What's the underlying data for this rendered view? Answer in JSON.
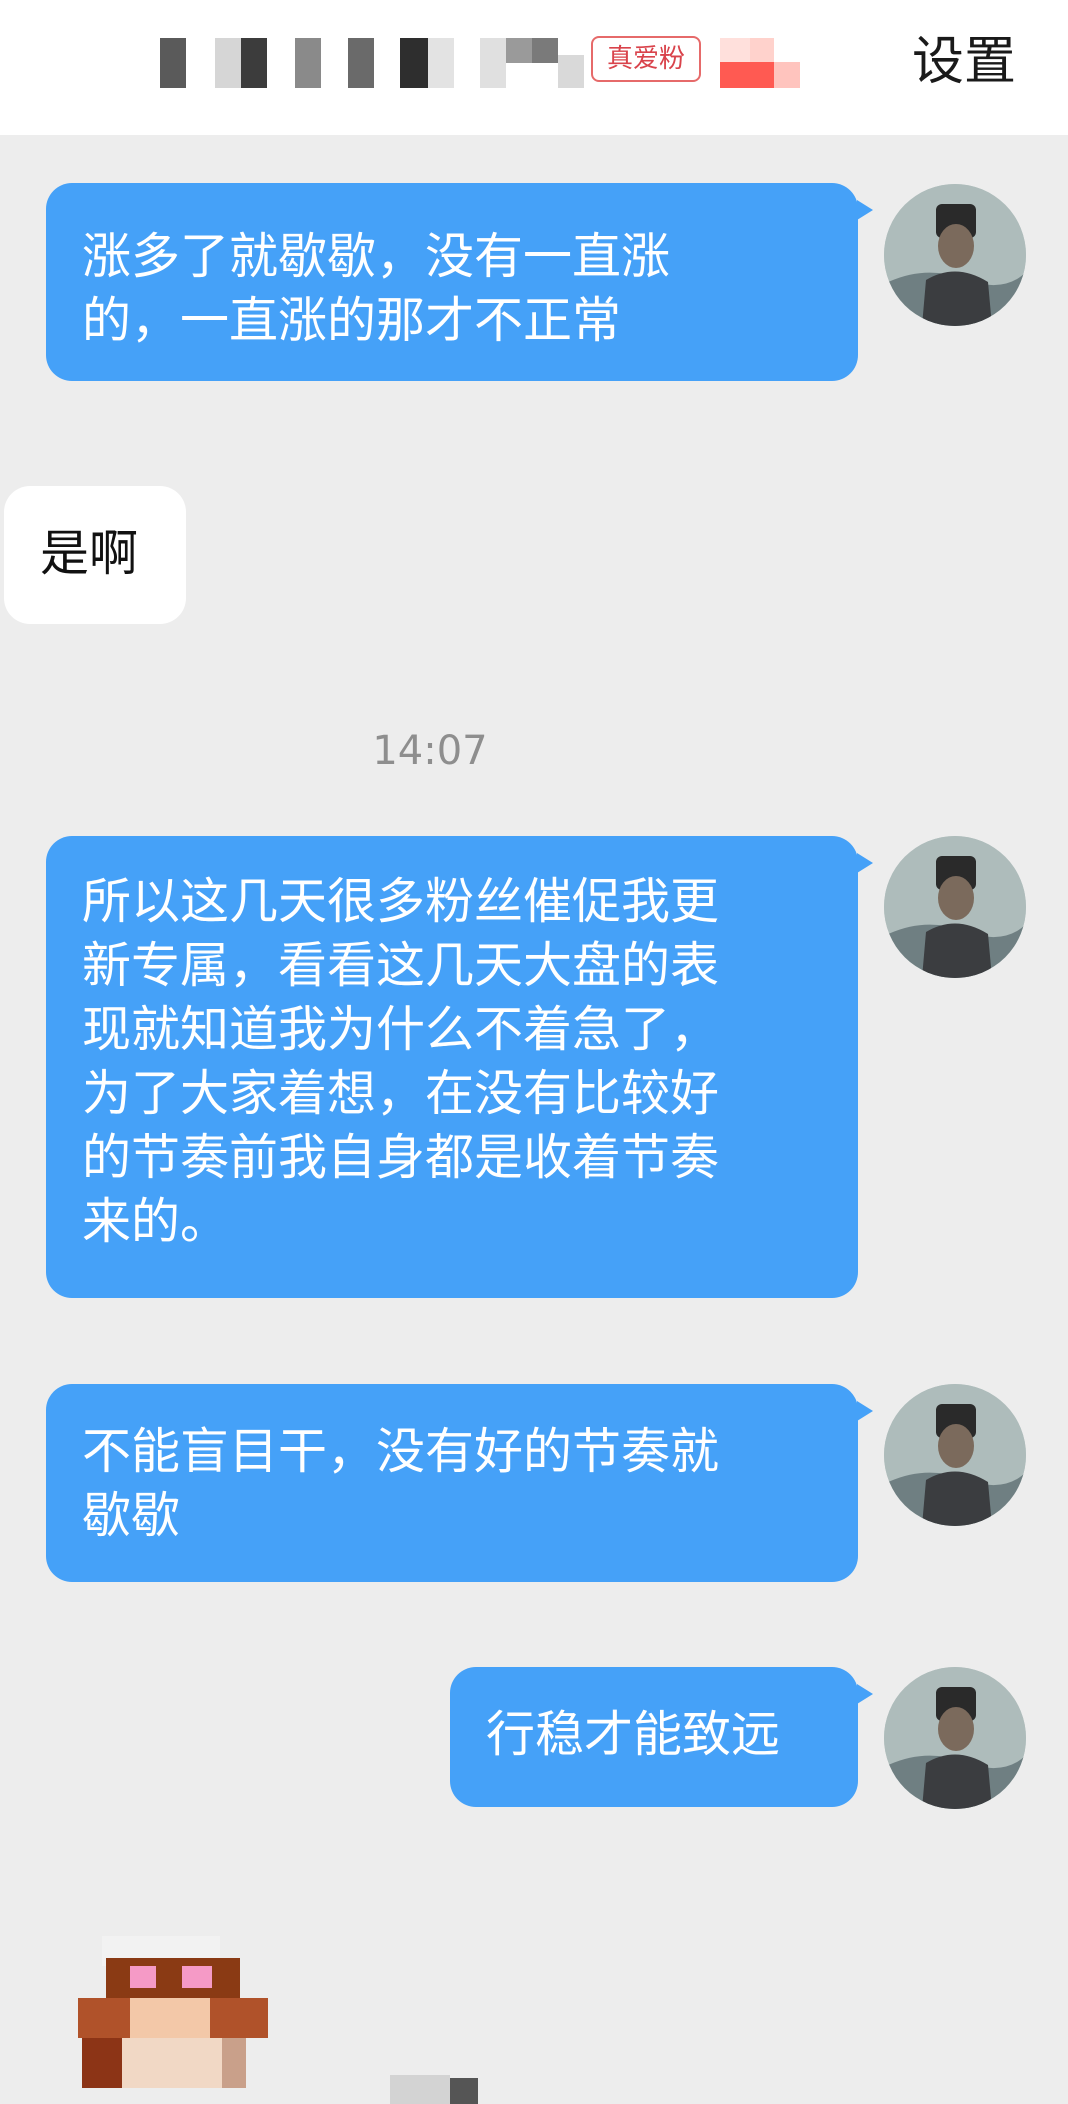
{
  "header": {
    "badge": "真爱粉",
    "settings_label": "设置"
  },
  "messages": [
    {
      "side": "out",
      "text": "涨多了就歇歇，没有一直涨\n的，一直涨的那才不正常"
    },
    {
      "side": "in",
      "text": "是啊"
    },
    {
      "side": "out",
      "text": "所以这几天很多粉丝催促我更\n新专属，看看这几天大盘的表\n现就知道我为什么不着急了，\n为了大家着想，在没有比较好\n的节奏前我自身都是收着节奏\n来的。"
    },
    {
      "side": "out",
      "text": "不能盲目干，没有好的节奏就\n歇歇"
    },
    {
      "side": "out",
      "text": "行稳才能致远"
    }
  ],
  "timestamp": "14:07",
  "colors": {
    "outgoing_bubble": "#45a1f8",
    "incoming_bubble": "#ffffff",
    "background": "#ededed",
    "badge": "#d9434b"
  },
  "icons": {
    "avatar": "person-portrait-avatar",
    "sticker": "pixelated-sticker"
  }
}
